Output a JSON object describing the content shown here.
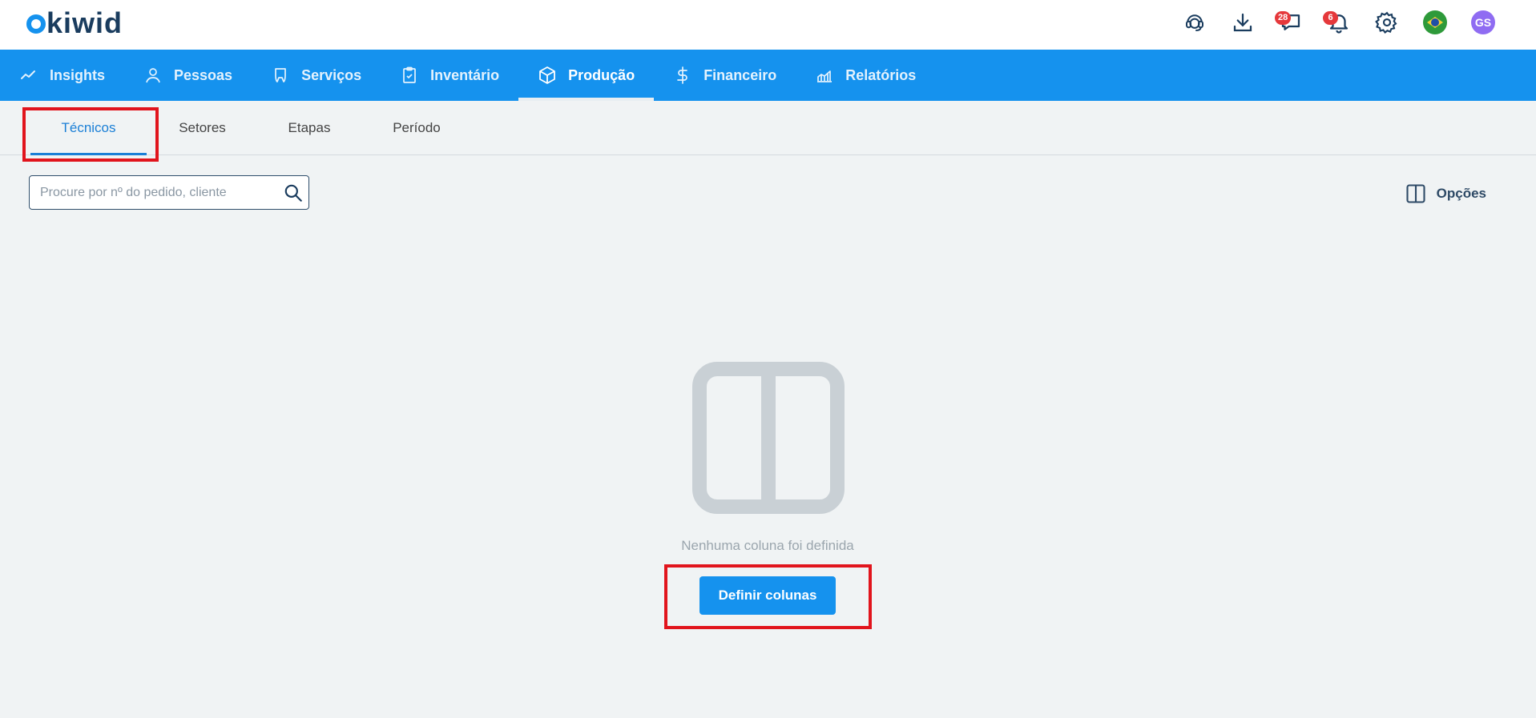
{
  "brand": {
    "logo_text": "kiwid",
    "accent": "#1592ee",
    "logo_color": "#1a3c5e"
  },
  "header": {
    "icons": [
      {
        "name": "headset-icon"
      },
      {
        "name": "download-icon"
      },
      {
        "name": "chat-icon",
        "badge": "28"
      },
      {
        "name": "bell-icon",
        "badge": "6"
      },
      {
        "name": "gear-icon"
      },
      {
        "name": "brazil-flag-icon"
      }
    ],
    "avatar_initials": "GS"
  },
  "nav": {
    "items": [
      {
        "label": "Insights",
        "icon": "trend-icon"
      },
      {
        "label": "Pessoas",
        "icon": "person-icon"
      },
      {
        "label": "Serviços",
        "icon": "tooth-icon"
      },
      {
        "label": "Inventário",
        "icon": "clipboard-icon"
      },
      {
        "label": "Produção",
        "icon": "box-icon",
        "active": true
      },
      {
        "label": "Financeiro",
        "icon": "dollar-icon"
      },
      {
        "label": "Relatórios",
        "icon": "chart-icon"
      }
    ]
  },
  "subtabs": [
    {
      "label": "Técnicos",
      "active": true
    },
    {
      "label": "Setores"
    },
    {
      "label": "Etapas"
    },
    {
      "label": "Período"
    }
  ],
  "search": {
    "placeholder": "Procure por nº do pedido, cliente"
  },
  "options_label": "Opções",
  "empty_state": {
    "message": "Nenhuma coluna foi definida",
    "button_label": "Definir colunas",
    "icon": "columns-icon"
  },
  "colors": {
    "highlight": "#e1141c",
    "badge": "#e5383b",
    "avatar": "#8f6cf2"
  }
}
